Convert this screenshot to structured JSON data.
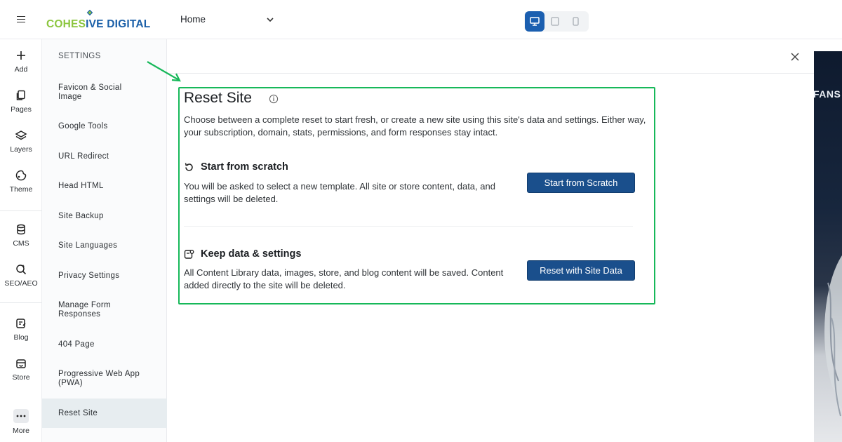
{
  "header": {
    "logo_part1": "COHES",
    "logo_part2": "IVE DIGITAL",
    "page_select_value": "Home",
    "devices": [
      "desktop-icon",
      "tablet-icon",
      "mobile-icon"
    ],
    "active_device": "desktop"
  },
  "rail": {
    "items": [
      {
        "label": "Add",
        "icon": "plus-icon"
      },
      {
        "label": "Pages",
        "icon": "pages-icon"
      },
      {
        "label": "Layers",
        "icon": "layers-icon"
      },
      {
        "label": "Theme",
        "icon": "theme-icon"
      },
      {
        "label": "CMS",
        "icon": "database-icon"
      },
      {
        "label": "SEO/AEO",
        "icon": "seo-icon"
      },
      {
        "label": "Blog",
        "icon": "blog-icon"
      },
      {
        "label": "Store",
        "icon": "store-icon"
      },
      {
        "label": "More",
        "icon": "more-icon"
      }
    ]
  },
  "settings": {
    "heading": "SETTINGS",
    "items": [
      "Favicon & Social Image",
      "Google Tools",
      "URL Redirect",
      "Head HTML",
      "Site Backup",
      "Site Languages",
      "Privacy Settings",
      "Manage Form Responses",
      "404 Page",
      "Progressive Web App (PWA)",
      "Reset Site"
    ],
    "active_item": "Reset Site"
  },
  "reset": {
    "title": "Reset Site",
    "description": "Choose between a complete reset to start fresh, or create a new site using this site's data and settings. Either way, your subscription, domain, stats, permissions, and form responses stay intact.",
    "scratch": {
      "heading": "Start from scratch",
      "body": "You will be asked to select a new template. All site or store content, data, and settings will be deleted.",
      "button": "Start from Scratch"
    },
    "keep": {
      "heading": "Keep data & settings",
      "body": "All Content Library data, images, store, and blog content will be saved. Content added directly to the site will be deleted.",
      "button": "Reset with Site Data"
    }
  },
  "preview": {
    "text": "FANS"
  },
  "colors": {
    "highlight": "#17b85a",
    "primary_button": "#1a4f8c",
    "active_device": "#1b5fb0",
    "logo_green": "#8cc63f",
    "logo_blue": "#1a5fa8"
  }
}
